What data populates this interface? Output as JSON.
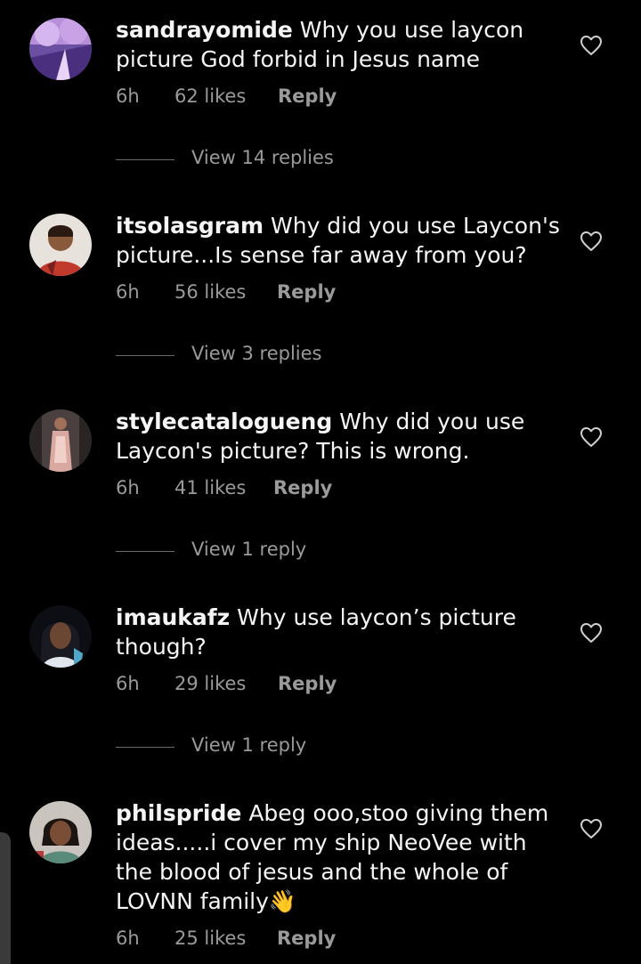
{
  "comments": [
    {
      "username": "sandrayomide",
      "text": "Why you use laycon picture God forbid in Jesus name",
      "time": "6h",
      "likes": "62 likes",
      "reply": "Reply",
      "view_replies": "View 14 replies"
    },
    {
      "username": "itsolasgram",
      "text": "Why did you use Laycon's picture...Is sense far away from you?",
      "time": "6h",
      "likes": "56 likes",
      "reply": "Reply",
      "view_replies": "View 3 replies"
    },
    {
      "username": "stylecatalogueng",
      "text": "Why did you use Laycon's picture? This is wrong.",
      "time": "6h",
      "likes": "41 likes",
      "reply": "Reply",
      "view_replies": "View 1 reply"
    },
    {
      "username": "imaukafz",
      "text": "Why use laycon’s picture though?",
      "time": "6h",
      "likes": "29 likes",
      "reply": "Reply",
      "view_replies": "View 1 reply"
    },
    {
      "username": "philspride",
      "text": "Abeg ooo,stoo giving them ideas.....i cover my ship NeoVee with the blood of jesus and the whole of LOVNN family👋",
      "time": "6h",
      "likes": "25 likes",
      "reply": "Reply"
    }
  ],
  "icons": {
    "like": "heart-outline-icon"
  },
  "colors": {
    "background": "#000000",
    "text": "#f5f5f5",
    "secondary": "#9a9a9a"
  }
}
